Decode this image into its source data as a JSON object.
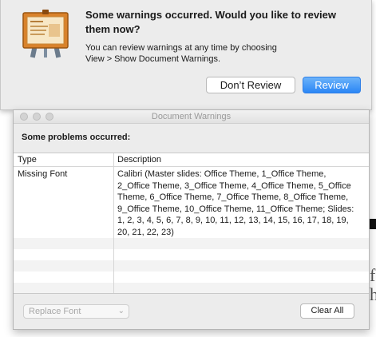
{
  "alert": {
    "app_icon": "keynote-icon",
    "title": "Some warnings occurred. Would you like to review them now?",
    "message": "You can review warnings at any time by choosing\nView > Show Document Warnings.",
    "buttons": {
      "dont_review": "Don’t Review",
      "review": "Review"
    }
  },
  "panel": {
    "window_title": "Document Warnings",
    "problems_label": "Some problems occurred:",
    "table": {
      "columns": [
        "Type",
        "Description"
      ],
      "rows": [
        {
          "type": "Missing Font",
          "description": "Calibri (Master slides: Office Theme, 1_Office Theme, 2_Office Theme, 3_Office Theme, 4_Office Theme, 5_Office Theme, 6_Office Theme, 7_Office Theme, 8_Office Theme, 9_Office Theme, 10_Office Theme, 11_Office Theme; Slides: 1, 2, 3, 4, 5, 6, 7, 8, 9, 10, 11, 12, 13, 14, 15, 16, 17, 18, 19, 20, 21, 22, 23)"
        }
      ]
    },
    "replace_font_label": "Replace Font",
    "clear_all_label": "Clear All"
  },
  "background": {
    "text1": "f",
    "text2": "h"
  },
  "colors": {
    "accent": "#2a86f5",
    "panel_bg": "#ececec"
  }
}
